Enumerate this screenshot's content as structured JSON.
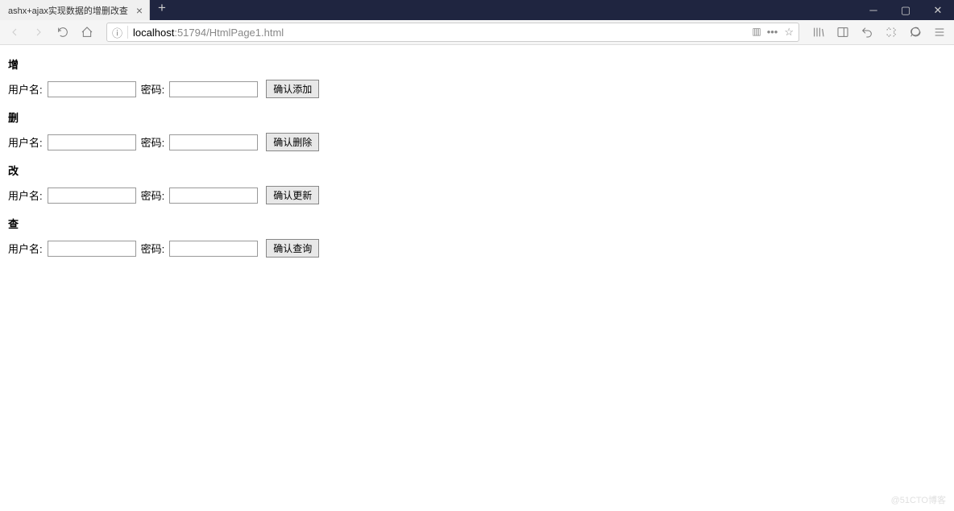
{
  "tab": {
    "title": "ashx+ajax实现数据的增删改查"
  },
  "url": {
    "host": "localhost",
    "port": ":51794",
    "path": "/HtmlPage1.html"
  },
  "sections": {
    "add": {
      "title": "增",
      "user_label": "用户名:",
      "pwd_label": "密码:",
      "btn": "确认添加"
    },
    "delete": {
      "title": "删",
      "user_label": "用户名:",
      "pwd_label": "密码:",
      "btn": "确认删除"
    },
    "update": {
      "title": "改",
      "user_label": "用户名:",
      "pwd_label": "密码:",
      "btn": "确认更新"
    },
    "query": {
      "title": "查",
      "user_label": "用户名:",
      "pwd_label": "密码:",
      "btn": "确认查询"
    }
  },
  "watermark": "@51CTO博客"
}
